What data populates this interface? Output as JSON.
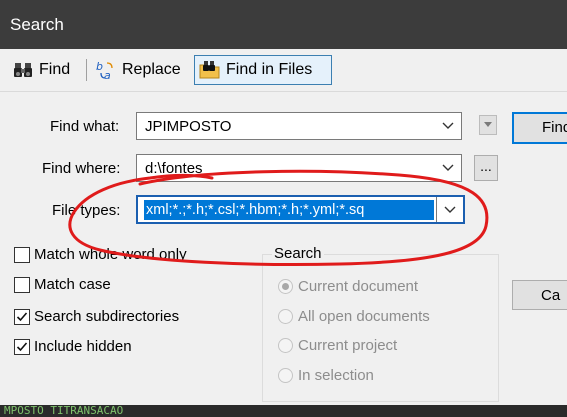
{
  "window": {
    "title": "Search"
  },
  "toolbar": {
    "find_label": "Find",
    "replace_label": "Replace",
    "find_in_files_label": "Find in Files",
    "active_tab": "Find in Files"
  },
  "form": {
    "find_what": {
      "label": "Find what:",
      "value": "JPIMPOSTO"
    },
    "find_where": {
      "label": "Find where:",
      "value": "d:\\fontes",
      "browse_label": "..."
    },
    "file_types": {
      "label": "File types:",
      "value": "xml;*.;*.h;*.csl;*.hbm;*.h;*.yml;*.sq"
    }
  },
  "buttons": {
    "find_label": "Find",
    "cancel_label": "Ca"
  },
  "options": [
    {
      "label": "Match whole word only",
      "checked": false
    },
    {
      "label": "Match case",
      "checked": false
    },
    {
      "label": "Search subdirectories",
      "checked": true
    },
    {
      "label": "Include hidden",
      "checked": true
    }
  ],
  "search_group": {
    "title": "Search",
    "items": [
      {
        "label": "Current document",
        "selected": true
      },
      {
        "label": "All open documents",
        "selected": false
      },
      {
        "label": "Current project",
        "selected": false
      },
      {
        "label": "In selection",
        "selected": false
      }
    ]
  },
  "background_text": "MPOSTO TITRANSACAO",
  "colors": {
    "titlebar": "#3c3c3c",
    "selection": "#0078d7",
    "annotation": "#e01b1b"
  }
}
